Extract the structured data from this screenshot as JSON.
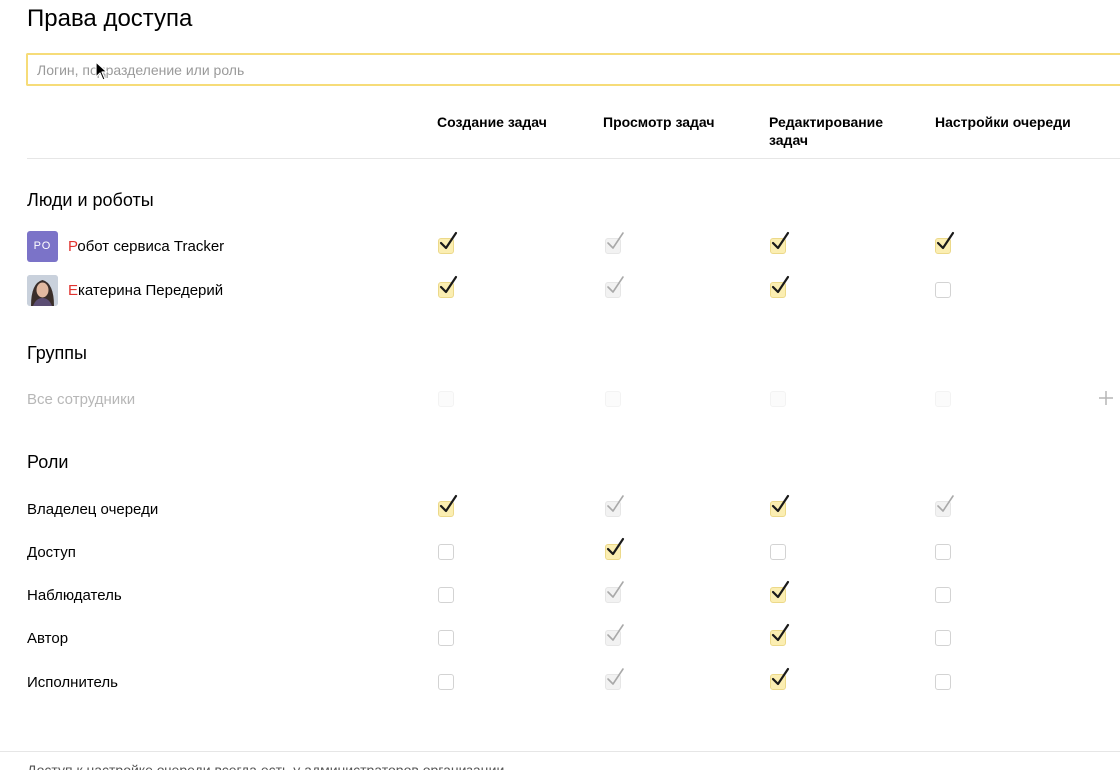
{
  "title": "Права доступа",
  "search": {
    "placeholder": "Логин, подразделение или роль",
    "value": ""
  },
  "columns": [
    "Создание задач",
    "Просмотр задач",
    "Редактирование задач",
    "Настройки очереди"
  ],
  "people": {
    "title": "Люди и роботы",
    "rows": [
      {
        "first_letter": "Р",
        "rest": "обот сервиса Tracker",
        "avatar_type": "initials",
        "avatar_initials": "РО",
        "avatar_color": "#7b73c8",
        "perms": [
          "checked",
          "disabled-checked",
          "checked",
          "checked"
        ]
      },
      {
        "first_letter": "Е",
        "rest": "катерина Передерий",
        "avatar_type": "photo",
        "perms": [
          "checked",
          "disabled-checked",
          "checked",
          "unchecked"
        ]
      }
    ]
  },
  "groups": {
    "title": "Группы",
    "rows": [
      {
        "label": "Все сотрудники",
        "perms": [
          "ghost",
          "ghost",
          "ghost",
          "ghost"
        ]
      }
    ]
  },
  "roles": {
    "title": "Роли",
    "rows": [
      {
        "label": "Владелец очереди",
        "perms": [
          "checked",
          "disabled-checked",
          "checked",
          "disabled-checked"
        ]
      },
      {
        "label": "Доступ",
        "perms": [
          "unchecked",
          "checked",
          "unchecked",
          "unchecked"
        ]
      },
      {
        "label": "Наблюдатель",
        "perms": [
          "unchecked",
          "disabled-checked",
          "checked",
          "unchecked"
        ]
      },
      {
        "label": "Автор",
        "perms": [
          "unchecked",
          "disabled-checked",
          "checked",
          "unchecked"
        ]
      },
      {
        "label": "Исполнитель",
        "perms": [
          "unchecked",
          "disabled-checked",
          "checked",
          "unchecked"
        ]
      }
    ]
  },
  "footer_note": "Доступ к настройке очереди всегда есть у администраторов организации",
  "colors": {
    "search_border": "#f6dc79",
    "checked_fill": "#fbeeb2",
    "first_letter": "#e0332f"
  }
}
